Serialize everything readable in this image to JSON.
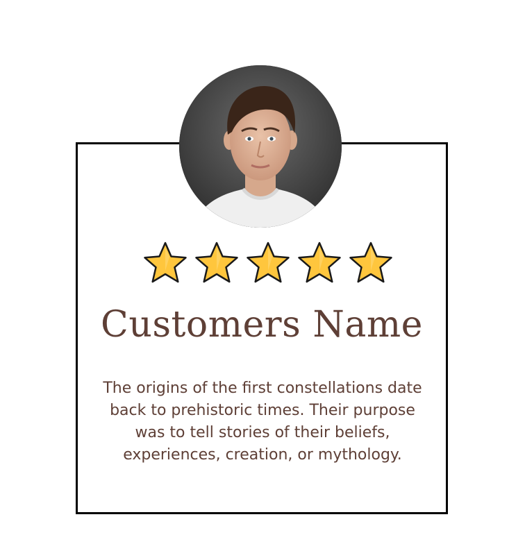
{
  "testimonial": {
    "rating": 5,
    "rating_max": 5,
    "customer_name": "Customers Name",
    "quote": "The origins of the first constellations date back to prehistoric times. Their purpose was to tell stories of their beliefs, experiences, creation, or mythology.",
    "avatar_icon": "person-portrait-photo",
    "star_icon": "star-icon"
  },
  "colors": {
    "text": "#5e3f36",
    "star_fill": "#ffc63d",
    "star_outline": "#1a1a1a",
    "card_border": "#000000",
    "photo_background": "#3e3e3e"
  }
}
